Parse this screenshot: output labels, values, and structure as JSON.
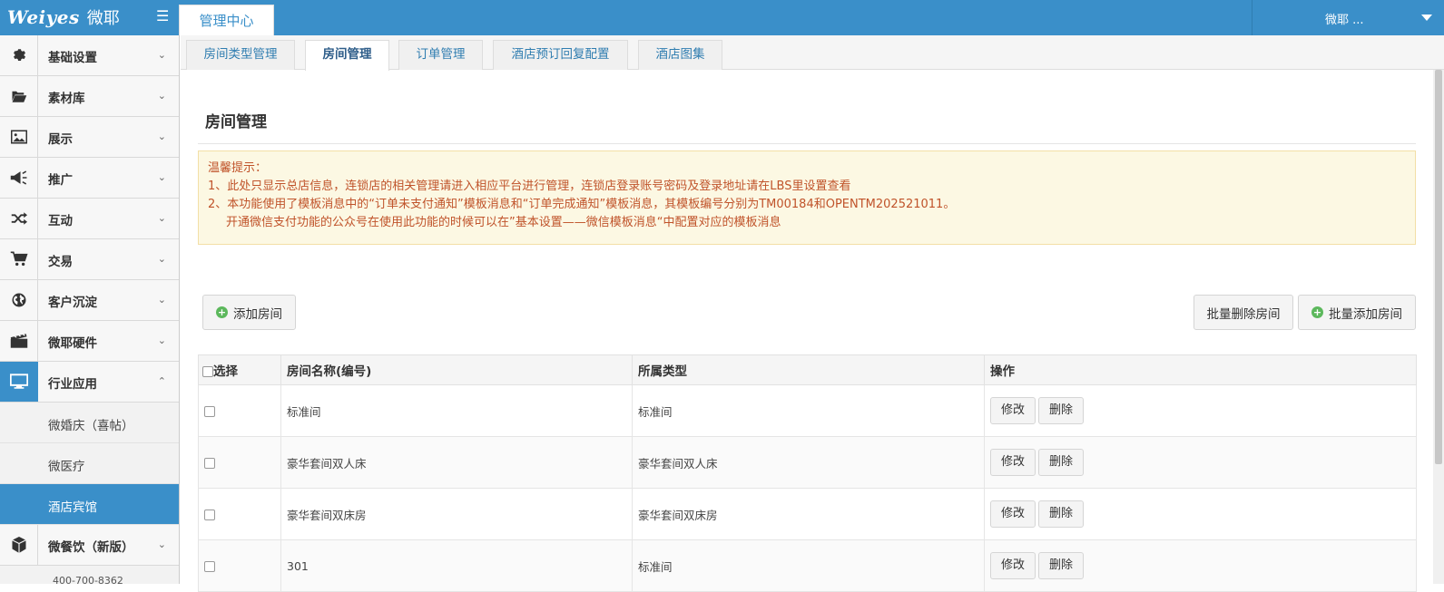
{
  "topbar": {
    "brand": "Weiyes",
    "brand_cn": "微耶",
    "menu_icon": "hamburger-icon",
    "active_tab": "管理中心",
    "user": "微耶 ..."
  },
  "sidebar": {
    "items": [
      {
        "label": "基础设置",
        "icon": "gear-icon"
      },
      {
        "label": "素材库",
        "icon": "folder-open-icon"
      },
      {
        "label": "展示",
        "icon": "image-icon"
      },
      {
        "label": "推广",
        "icon": "megaphone-icon"
      },
      {
        "label": "互动",
        "icon": "shuffle-icon"
      },
      {
        "label": "交易",
        "icon": "cart-icon"
      },
      {
        "label": "客户沉淀",
        "icon": "globe-icon"
      },
      {
        "label": "微耶硬件",
        "icon": "film-icon"
      },
      {
        "label": "行业应用",
        "icon": "monitor-icon"
      }
    ],
    "sub_items": [
      "微婚庆（喜帖）",
      "微医疗",
      "酒店宾馆"
    ],
    "extra_item": {
      "label": "微餐饮（新版）",
      "icon": "cube-icon"
    },
    "phone": "400-700-8362"
  },
  "tabs": [
    "房间类型管理",
    "房间管理",
    "订单管理",
    "酒店预订回复配置",
    "酒店图集"
  ],
  "page": {
    "title": "房间管理",
    "notice": {
      "heading": "温馨提示：",
      "line1": "1、此处只显示总店信息，连锁店的相关管理请进入相应平台进行管理，连锁店登录账号密码及登录地址请在LBS里设置查看",
      "line2": "2、本功能使用了模板消息中的“订单未支付通知”模板消息和“订单完成通知”模板消息，其模板编号分别为TM00184和OPENTM202521011。",
      "line3": "开通微信支付功能的公众号在使用此功能的时候可以在”基本设置——微信模板消息“中配置对应的模板消息"
    },
    "buttons": {
      "add": "添加房间",
      "batch_delete": "批量删除房间",
      "batch_add": "批量添加房间"
    }
  },
  "table": {
    "headers": [
      "选择",
      "房间名称(编号)",
      "所属类型",
      "操作"
    ],
    "rows": [
      {
        "name": "标准间",
        "type": "标准间"
      },
      {
        "name": "豪华套间双人床",
        "type": "豪华套间双人床"
      },
      {
        "name": "豪华套间双床房",
        "type": "豪华套间双床房"
      },
      {
        "name": "301",
        "type": "标准间"
      }
    ],
    "edit_label": "修改",
    "delete_label": "删除"
  },
  "colors": {
    "primary": "#3a8fc9",
    "notice_bg": "#fcf8e3",
    "notice_text": "#c0532a"
  }
}
